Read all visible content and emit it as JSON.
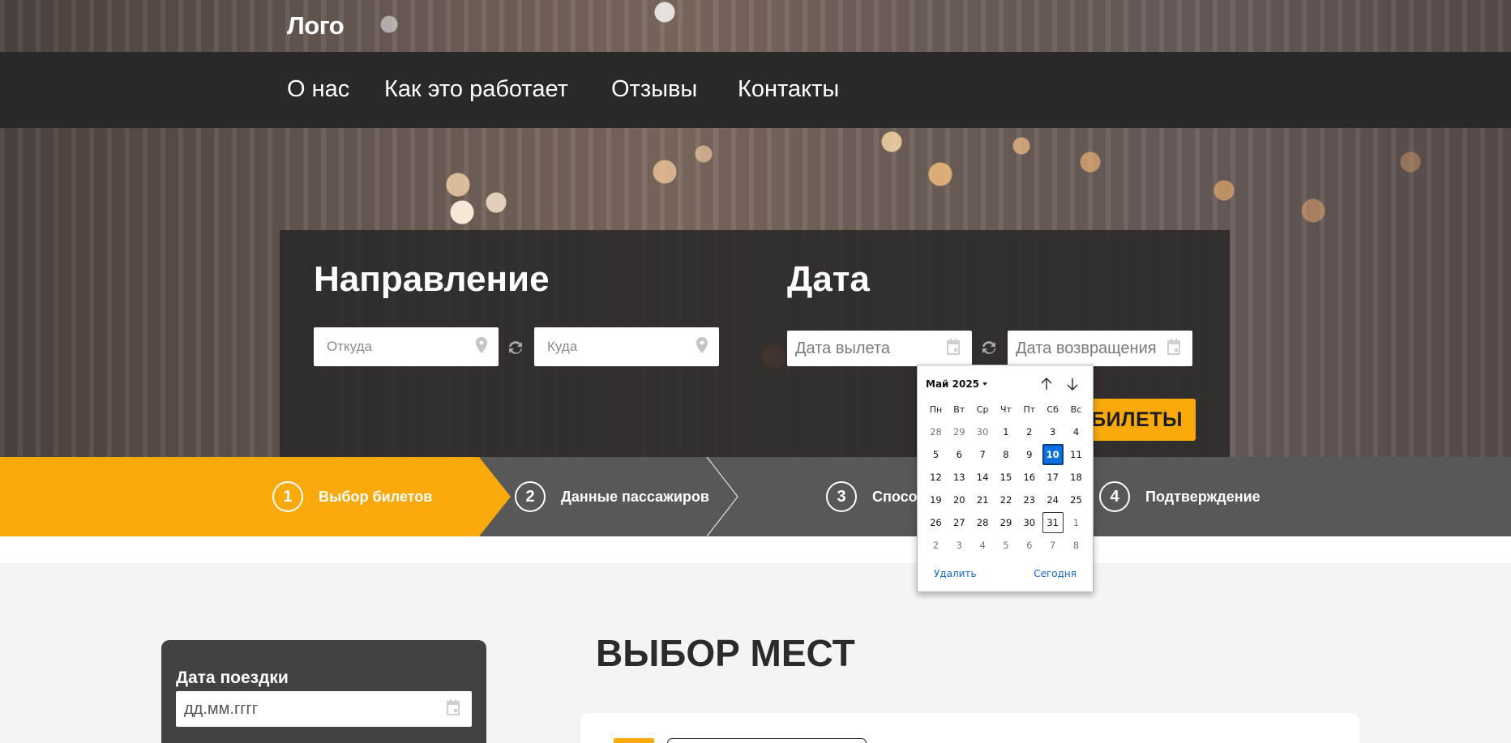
{
  "header": {
    "logo": "Лого",
    "nav": [
      "О нас",
      "Как это работает",
      "Отзывы",
      "Контакты"
    ]
  },
  "search": {
    "direction_title": "Направление",
    "date_title": "Дата",
    "from_placeholder": "Откуда",
    "to_placeholder": "Куда",
    "depart_placeholder": "Дата вылета",
    "return_placeholder": "Дата возвращения",
    "find_button": "НАЙТИ БИЛЕТЫ",
    "find_button_visible": "БИЛЕТЫ"
  },
  "steps": [
    {
      "num": "1",
      "label": "Выбор билетов",
      "active": true
    },
    {
      "num": "2",
      "label": "Данные пассажиров",
      "active": false
    },
    {
      "num": "3",
      "label": "Способ оплаты",
      "active": false
    },
    {
      "num": "4",
      "label": "Подтверждение",
      "active": false
    }
  ],
  "steps_visible": {
    "step3_label": "Спосо"
  },
  "sidebar": {
    "trip_date_label": "Дата поездки",
    "trip_date_placeholder": "дд.мм.гггг"
  },
  "main": {
    "title": "ВЫБОР МЕСТ"
  },
  "datepicker": {
    "month_label": "Май 2025",
    "weekdays": [
      "Пн",
      "Вт",
      "Ср",
      "Чт",
      "Пт",
      "Сб",
      "Вс"
    ],
    "weeks": [
      [
        [
          "28",
          true
        ],
        [
          "29",
          true
        ],
        [
          "30",
          true
        ],
        [
          "1",
          false
        ],
        [
          "2",
          false
        ],
        [
          "3",
          false
        ],
        [
          "4",
          false
        ]
      ],
      [
        [
          "5",
          false
        ],
        [
          "6",
          false
        ],
        [
          "7",
          false
        ],
        [
          "8",
          false
        ],
        [
          "9",
          false
        ],
        [
          "10",
          false
        ],
        [
          "11",
          false
        ]
      ],
      [
        [
          "12",
          false
        ],
        [
          "13",
          false
        ],
        [
          "14",
          false
        ],
        [
          "15",
          false
        ],
        [
          "16",
          false
        ],
        [
          "17",
          false
        ],
        [
          "18",
          false
        ]
      ],
      [
        [
          "19",
          false
        ],
        [
          "20",
          false
        ],
        [
          "21",
          false
        ],
        [
          "22",
          false
        ],
        [
          "23",
          false
        ],
        [
          "24",
          false
        ],
        [
          "25",
          false
        ]
      ],
      [
        [
          "26",
          false
        ],
        [
          "27",
          false
        ],
        [
          "28",
          false
        ],
        [
          "29",
          false
        ],
        [
          "30",
          false
        ],
        [
          "31",
          false
        ],
        [
          "1",
          true
        ]
      ],
      [
        [
          "2",
          true
        ],
        [
          "3",
          true
        ],
        [
          "4",
          true
        ],
        [
          "5",
          true
        ],
        [
          "6",
          true
        ],
        [
          "7",
          true
        ],
        [
          "8",
          true
        ]
      ]
    ],
    "selected_day": "10",
    "today_day": "31",
    "clear_label": "Удалить",
    "today_label": "Сегодня"
  },
  "colors": {
    "accent": "#f9a90a",
    "nav_bg": "#292929",
    "steps_bg": "#585858",
    "selected_day": "#0a6fe0",
    "link": "#1468c7"
  }
}
